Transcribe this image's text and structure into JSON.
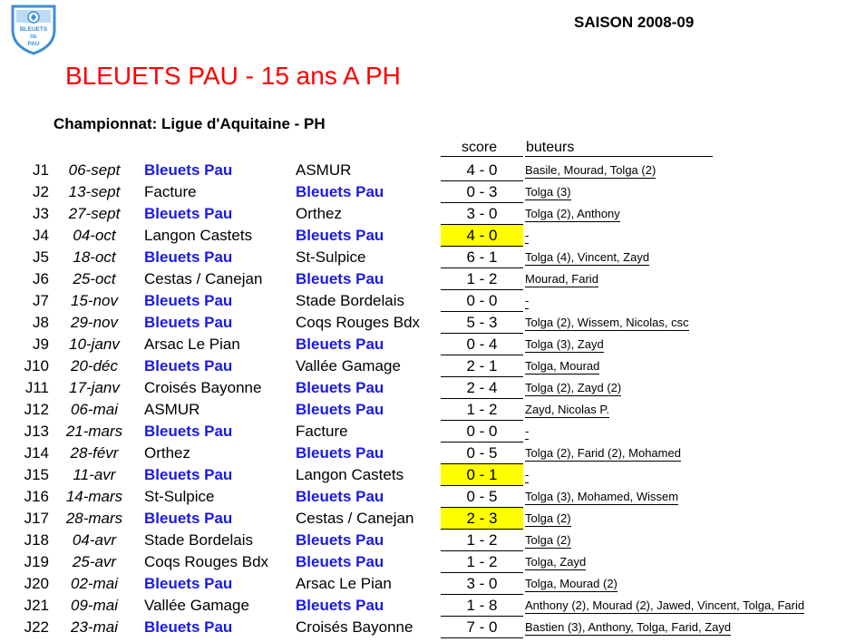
{
  "header": {
    "logo_text": "BLEUETS DE PAU",
    "season": "SAISON 2008-09",
    "title": "BLEUETS PAU - 15 ans A PH",
    "subtitle": "Championnat: Ligue d'Aquitaine - PH"
  },
  "columns": {
    "score": "score",
    "buteurs": "buteurs"
  },
  "colors": {
    "title": "#ff0000",
    "team": "#1a1ae6",
    "highlight": "#ffff00"
  },
  "matches": [
    {
      "j": "J1",
      "date": "06-sept",
      "home": "Bleuets Pau",
      "away": "ASMUR",
      "score": "4 - 0",
      "buteurs": "Basile, Mourad, Tolga (2)",
      "highlight": false
    },
    {
      "j": "J2",
      "date": "13-sept",
      "home": "Facture",
      "away": "Bleuets Pau",
      "score": "0 - 3",
      "buteurs": "Tolga (3)",
      "highlight": false
    },
    {
      "j": "J3",
      "date": "27-sept",
      "home": "Bleuets Pau",
      "away": "Orthez",
      "score": "3 - 0",
      "buteurs": "Tolga (2), Anthony",
      "highlight": false
    },
    {
      "j": "J4",
      "date": "04-oct",
      "home": "Langon Castets",
      "away": "Bleuets Pau",
      "score": "4 - 0",
      "buteurs": "-",
      "highlight": true
    },
    {
      "j": "J5",
      "date": "18-oct",
      "home": "Bleuets Pau",
      "away": "St-Sulpice",
      "score": "6 - 1",
      "buteurs": "Tolga (4), Vincent, Zayd",
      "highlight": false
    },
    {
      "j": "J6",
      "date": "25-oct",
      "home": "Cestas / Canejan",
      "away": "Bleuets Pau",
      "score": "1 - 2",
      "buteurs": "Mourad, Farid",
      "highlight": false
    },
    {
      "j": "J7",
      "date": "15-nov",
      "home": "Bleuets Pau",
      "away": "Stade Bordelais",
      "score": "0 - 0",
      "buteurs": "-",
      "highlight": false
    },
    {
      "j": "J8",
      "date": "29-nov",
      "home": "Bleuets Pau",
      "away": "Coqs Rouges Bdx",
      "score": "5 - 3",
      "buteurs": "Tolga (2), Wissem, Nicolas, csc",
      "highlight": false
    },
    {
      "j": "J9",
      "date": "10-janv",
      "home": "Arsac Le Pian",
      "away": "Bleuets Pau",
      "score": "0 - 4",
      "buteurs": "Tolga (3), Zayd",
      "highlight": false
    },
    {
      "j": "J10",
      "date": "20-déc",
      "home": "Bleuets Pau",
      "away": "Vallée Gamage",
      "score": "2 - 1",
      "buteurs": "Tolga, Mourad",
      "highlight": false
    },
    {
      "j": "J11",
      "date": "17-janv",
      "home": "Croisés Bayonne",
      "away": "Bleuets Pau",
      "score": "2 - 4",
      "buteurs": "Tolga (2), Zayd (2)",
      "highlight": false
    },
    {
      "j": "J12",
      "date": "06-mai",
      "home": "ASMUR",
      "away": "Bleuets Pau",
      "score": "1 - 2",
      "buteurs": "Zayd, Nicolas P.",
      "highlight": false
    },
    {
      "j": "J13",
      "date": "21-mars",
      "home": "Bleuets Pau",
      "away": "Facture",
      "score": "0 - 0",
      "buteurs": "-",
      "highlight": false
    },
    {
      "j": "J14",
      "date": "28-févr",
      "home": "Orthez",
      "away": "Bleuets Pau",
      "score": "0 - 5",
      "buteurs": "Tolga (2), Farid (2), Mohamed",
      "highlight": false
    },
    {
      "j": "J15",
      "date": "11-avr",
      "home": "Bleuets Pau",
      "away": "Langon Castets",
      "score": "0 - 1",
      "buteurs": "-",
      "highlight": true
    },
    {
      "j": "J16",
      "date": "14-mars",
      "home": "St-Sulpice",
      "away": "Bleuets Pau",
      "score": "0 - 5",
      "buteurs": "Tolga (3), Mohamed, Wissem",
      "highlight": false
    },
    {
      "j": "J17",
      "date": "28-mars",
      "home": "Bleuets Pau",
      "away": "Cestas / Canejan",
      "score": "2 - 3",
      "buteurs": "Tolga (2)",
      "highlight": true
    },
    {
      "j": "J18",
      "date": "04-avr",
      "home": "Stade Bordelais",
      "away": "Bleuets Pau",
      "score": "1 - 2",
      "buteurs": "Tolga (2)",
      "highlight": false
    },
    {
      "j": "J19",
      "date": "25-avr",
      "home": "Coqs Rouges Bdx",
      "away": "Bleuets Pau",
      "score": "1 - 2",
      "buteurs": "Tolga, Zayd",
      "highlight": false
    },
    {
      "j": "J20",
      "date": "02-mai",
      "home": "Bleuets Pau",
      "away": "Arsac Le Pian",
      "score": "3 - 0",
      "buteurs": "Tolga, Mourad (2)",
      "highlight": false
    },
    {
      "j": "J21",
      "date": "09-mai",
      "home": "Vallée Gamage",
      "away": "Bleuets Pau",
      "score": "1 - 8",
      "buteurs": "Anthony (2), Mourad (2), Jawed, Vincent, Tolga, Farid",
      "highlight": false
    },
    {
      "j": "J22",
      "date": "23-mai",
      "home": "Bleuets Pau",
      "away": "Croisés Bayonne",
      "score": "7 - 0",
      "buteurs": "Bastien (3), Anthony, Tolga, Farid, Zayd",
      "highlight": false
    }
  ]
}
